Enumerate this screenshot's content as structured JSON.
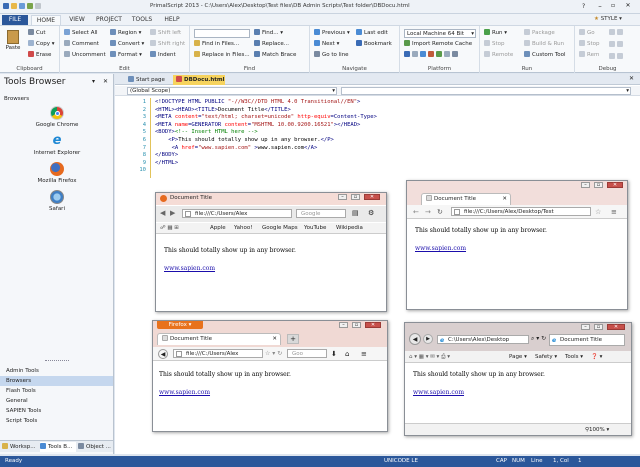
{
  "app": {
    "title": "PrimalScript 2013 - C:\\Users\\Alex\\Desktop\\Test files\\DB Admin Scripts\\Test folder\\DBDocu.html",
    "style_label": "STYLE"
  },
  "menu_tabs": [
    "FILE",
    "HOME",
    "VIEW",
    "PROJECT",
    "TOOLS",
    "HELP"
  ],
  "ribbon": {
    "clipboard": {
      "label": "Clipboard",
      "paste": "Paste",
      "cut": "Cut",
      "copy": "Copy",
      "erase": "Erase"
    },
    "edit": {
      "label": "Edit",
      "select_all": "Select All",
      "comment": "Comment",
      "uncomment": "Uncomment",
      "region": "Region",
      "convert": "Convert",
      "format": "Format",
      "shift_left": "Shift left",
      "shift_right": "Shift right",
      "indent": "Indent"
    },
    "find": {
      "label": "Find",
      "find": "Find...",
      "find_in_files": "Find in Files...",
      "replace": "Replace...",
      "replace_in_files": "Replace in Files...",
      "match_brace": "Match Brace",
      "find_placeholder": ""
    },
    "navigate": {
      "label": "Navigate",
      "previous": "Previous",
      "next": "Next",
      "go_to_line": "Go to line",
      "last_edit": "Last edit",
      "bookmark": "Bookmark"
    },
    "platform": {
      "label": "Platform",
      "machine": "Local Machine 64 Bit",
      "import_cache": "Import Remote Cache"
    },
    "run": {
      "label": "Run",
      "run": "Run",
      "stop": "Stop",
      "remote": "Remote",
      "package": "Package",
      "build_run": "Build & Run",
      "custom_tool": "Custom Tool"
    },
    "debug": {
      "label": "Debug",
      "go": "Go",
      "stop": "Stop",
      "remote": "Rem"
    }
  },
  "tools_browser": {
    "title": "Tools Browser",
    "section": "Browsers",
    "browsers": [
      "Google Chrome",
      "Internet Explorer",
      "Mozilla Firefox",
      "Safari"
    ],
    "categories": [
      "Admin Tools",
      "Browsers",
      "Flash Tools",
      "General",
      "SAPIEN Tools",
      "Script Tools"
    ],
    "bottom_tabs": [
      "Worksp...",
      "Tools B...",
      "Object ..."
    ]
  },
  "editor": {
    "doc_tabs": [
      "Start page",
      "DBDocu.html"
    ],
    "scope": "(Global Scope)",
    "line_numbers": [
      "1",
      "2",
      "3",
      "4",
      "5",
      "6",
      "7",
      "8",
      "9",
      "10"
    ]
  },
  "preview": {
    "doc_title": "Document Title",
    "body_text": "This should totally show up in any browser.",
    "link_text": "www.sapien.com",
    "path_short": "file:///C:/Users/Alex",
    "path_long": "file:///C:/Users/Alex/Desktop/Test",
    "search_placeholder": "Google",
    "search_placeholder_ff": "Goo",
    "ie_path": "C:\\Users\\Alex\\Desktop",
    "firefox_label": "Firefox",
    "bookmarks": [
      "Apple",
      "Yahoo!",
      "Google Maps",
      "YouTube",
      "Wikipedia"
    ],
    "ie_menus": [
      "Page",
      "Safety",
      "Tools"
    ],
    "zoom": "100%"
  },
  "status": {
    "left": "Ready",
    "encoding": "UNICODE LE",
    "caps": "CAP",
    "num": "NUM",
    "line": "Line",
    "line_val": "1, Col",
    "col_val": "1"
  }
}
